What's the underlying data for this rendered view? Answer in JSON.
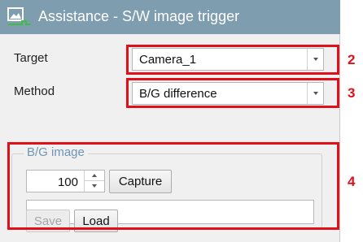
{
  "window": {
    "title": "Assistance - S/W image trigger",
    "icon": "image-trigger-icon"
  },
  "target": {
    "label": "Target",
    "value": "Camera_1"
  },
  "method": {
    "label": "Method",
    "value": "B/G difference"
  },
  "bg_image": {
    "legend": "B/G image",
    "count": "100",
    "capture_label": "Capture",
    "path_value": "",
    "save_label": "Save",
    "save_enabled": false,
    "load_label": "Load"
  },
  "callouts": [
    "2",
    "3",
    "4"
  ],
  "colors": {
    "titlebar": "#7e9daf",
    "highlight": "#e0101b",
    "legend": "#6f95b3",
    "panel": "#f0f0f0"
  }
}
